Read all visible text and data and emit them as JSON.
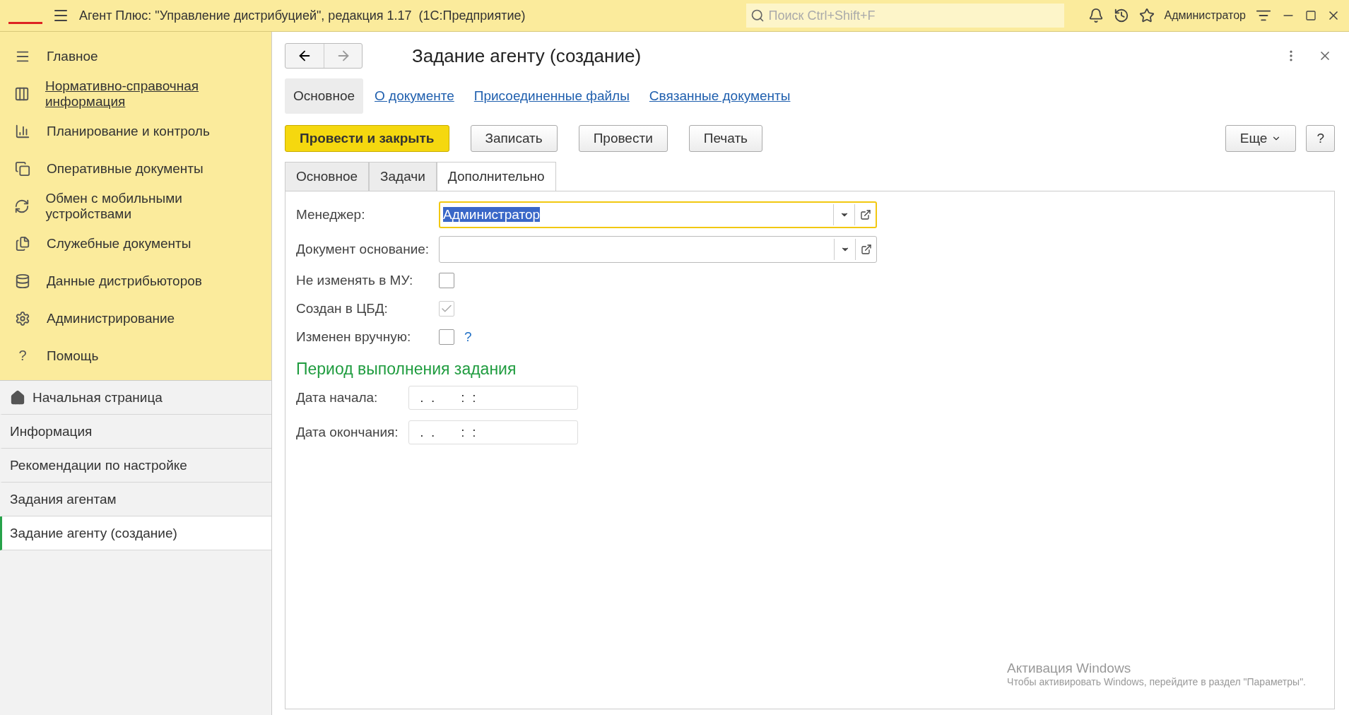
{
  "window": {
    "title": "Агент Плюс: \"Управление дистрибуцией\", редакция 1.17  (1С:Предприятие)",
    "search_placeholder": "Поиск Ctrl+Shift+F",
    "user": "Администратор"
  },
  "sections": [
    {
      "label": "Главное",
      "underlined": false
    },
    {
      "label": "Нормативно-справочная информация",
      "underlined": true
    },
    {
      "label": "Планирование и контроль",
      "underlined": false
    },
    {
      "label": "Оперативные документы",
      "underlined": false
    },
    {
      "label": "Обмен с мобильными устройствами",
      "underlined": false
    },
    {
      "label": "Служебные документы",
      "underlined": false
    },
    {
      "label": "Данные дистрибьюторов",
      "underlined": false
    },
    {
      "label": "Администрирование",
      "underlined": false
    },
    {
      "glyph": "?",
      "label": "Помощь",
      "underlined": false
    }
  ],
  "open_windows": [
    {
      "label": "Начальная страница",
      "home": true,
      "selected": false
    },
    {
      "label": "Информация",
      "home": false,
      "selected": false
    },
    {
      "label": "Рекомендации по настройке",
      "home": false,
      "selected": false
    },
    {
      "label": "Задания агентам",
      "home": false,
      "selected": false
    },
    {
      "label": "Задание агенту (создание)",
      "home": false,
      "selected": true
    }
  ],
  "form": {
    "title": "Задание агенту (создание)",
    "nav_tabs": [
      {
        "label": "Основное",
        "selected": true
      },
      {
        "label": "О документе",
        "selected": false
      },
      {
        "label": "Присоединенные файлы",
        "selected": false
      },
      {
        "label": "Связанные документы",
        "selected": false
      }
    ],
    "buttons": [
      {
        "label": "Провести и закрыть",
        "kind": "primary"
      },
      {
        "label": "Записать",
        "kind": "normal"
      },
      {
        "label": "Провести",
        "kind": "normal"
      },
      {
        "label": "Печать",
        "kind": "normal"
      }
    ],
    "more_button": "Еще",
    "help_button": "?",
    "tabs": [
      {
        "label": "Основное",
        "selected": false
      },
      {
        "label": "Задачи",
        "selected": false
      },
      {
        "label": "Дополнительно",
        "selected": true
      }
    ],
    "fields": [
      {
        "kind": "select",
        "label": "Менеджер:",
        "value": "Администратор",
        "focused": true
      },
      {
        "kind": "select",
        "label": "Документ основание:",
        "focused": false
      },
      {
        "kind": "checkbox",
        "label": "Не изменять в МУ:",
        "checked": false,
        "disabled": false
      },
      {
        "kind": "checkbox",
        "label": "Создан в ЦБД:",
        "checked": true,
        "disabled": true
      },
      {
        "kind": "checkbox",
        "label": "Изменен вручную:",
        "checked": false,
        "disabled": false,
        "hint": "?"
      }
    ],
    "period": {
      "title": "Период выполнения задания",
      "fields": [
        {
          "label": "Дата начала:",
          "value": " .  .       :  :"
        },
        {
          "label": "Дата окончания:",
          "value": " .  .       :  :"
        }
      ]
    }
  },
  "os_notice": {
    "title": "Активация Windows",
    "text": "Чтобы активировать Windows, перейдите в раздел \"Параметры\"."
  }
}
